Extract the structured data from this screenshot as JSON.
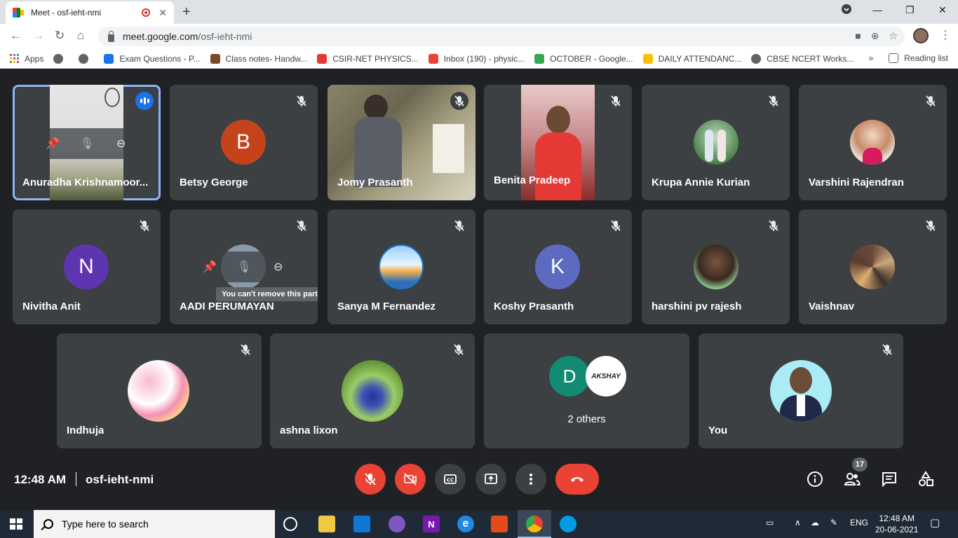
{
  "browser": {
    "tab_title": "Meet - osf-ieht-nmi",
    "url_host": "meet.google.com",
    "url_path": "/osf-ieht-nmi"
  },
  "bookmarks": [
    {
      "label": "Apps",
      "color": "#4285f4"
    },
    {
      "label": "",
      "color": "#5f6368"
    },
    {
      "label": "",
      "color": "#5f6368"
    },
    {
      "label": "Exam Questions - P...",
      "color": "#1a73e8"
    },
    {
      "label": "Class notes- Handw...",
      "color": "#7b4a2a"
    },
    {
      "label": "CSIR-NET PHYSICS...",
      "color": "#e53935"
    },
    {
      "label": "Inbox (190) - physic...",
      "color": "#ea4335"
    },
    {
      "label": "OCTOBER - Google...",
      "color": "#34a853"
    },
    {
      "label": "DAILY ATTENDANC...",
      "color": "#fbbc04"
    },
    {
      "label": "CBSE NCERT Works...",
      "color": "#5f6368"
    }
  ],
  "reading_list": "Reading list",
  "more_bookmarks": "»",
  "participants": [
    {
      "name": "Anuradha Krishnamoor...",
      "kind": "video"
    },
    {
      "name": "Betsy George",
      "kind": "letter",
      "letter": "B",
      "color": "#c5431b"
    },
    {
      "name": "Jomy Prasanth",
      "kind": "video"
    },
    {
      "name": "Benita Pradeep",
      "kind": "video"
    },
    {
      "name": "Krupa Annie Kurian",
      "kind": "photo"
    },
    {
      "name": "Varshini Rajendran",
      "kind": "photo"
    },
    {
      "name": "Nivitha Anit",
      "kind": "letter",
      "letter": "N",
      "color": "#5e35b1"
    },
    {
      "name": "AADI PERUMAYAN",
      "kind": "photo"
    },
    {
      "name": "Sanya M Fernandez",
      "kind": "photo"
    },
    {
      "name": "Koshy Prasanth",
      "kind": "letter",
      "letter": "K",
      "color": "#5c6bc0"
    },
    {
      "name": "harshini pv rajesh",
      "kind": "photo"
    },
    {
      "name": "Vaishnav",
      "kind": "photo"
    },
    {
      "name": "Indhuja",
      "kind": "photo"
    },
    {
      "name": "ashna lixon",
      "kind": "photo"
    },
    {
      "name": "2 others",
      "kind": "group",
      "letter": "D",
      "color": "#138a72",
      "second_avatar_text": "AKSHAY"
    },
    {
      "name": "You",
      "kind": "photo"
    }
  ],
  "tooltip": "You can't remove this participant",
  "meeting": {
    "time": "12:48 AM",
    "code": "osf-ieht-nmi",
    "participant_count": "17"
  },
  "taskbar": {
    "search_placeholder": "Type here to search",
    "language": "ENG",
    "time": "12:48 AM",
    "date": "20-06-2021"
  }
}
